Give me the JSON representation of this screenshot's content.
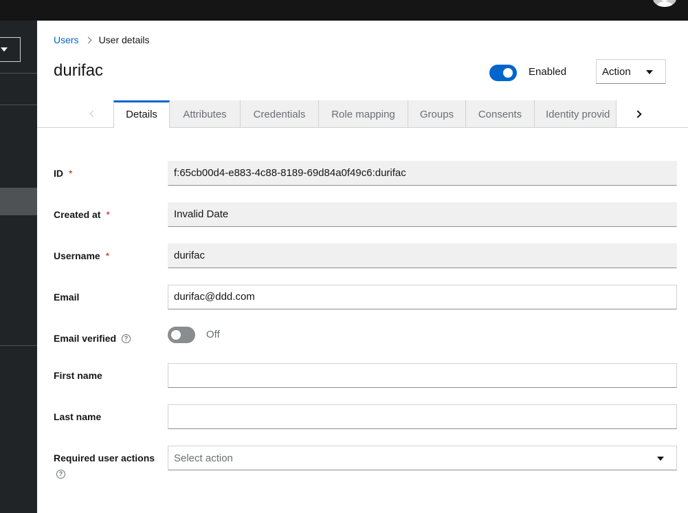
{
  "breadcrumb": {
    "parent": "Users",
    "current": "User details"
  },
  "page": {
    "title": "durifac"
  },
  "header": {
    "enabled_label": "Enabled",
    "enabled": true,
    "action_label": "Action"
  },
  "tabs": [
    {
      "label": "Details",
      "active": true
    },
    {
      "label": "Attributes"
    },
    {
      "label": "Credentials"
    },
    {
      "label": "Role mapping"
    },
    {
      "label": "Groups"
    },
    {
      "label": "Consents"
    },
    {
      "label": "Identity provid"
    }
  ],
  "form": {
    "id": {
      "label": "ID",
      "required": "*",
      "value": "f:65cb00d4-e883-4c88-8189-69d84a0f49c6:durifac"
    },
    "created_at": {
      "label": "Created at",
      "required": "*",
      "value": "Invalid Date"
    },
    "username": {
      "label": "Username",
      "required": "*",
      "value": "durifac"
    },
    "email": {
      "label": "Email",
      "value": "durifac@ddd.com"
    },
    "email_verified": {
      "label": "Email verified",
      "state_label": "Off",
      "value": false
    },
    "first_name": {
      "label": "First name",
      "value": ""
    },
    "last_name": {
      "label": "Last name",
      "value": ""
    },
    "required_actions": {
      "label": "Required user actions",
      "placeholder": "Select action"
    }
  },
  "icons": {
    "help": "?"
  },
  "colors": {
    "accent": "#0066cc",
    "masthead": "#151515",
    "sidebar": "#212427",
    "required": "#c9190b"
  }
}
